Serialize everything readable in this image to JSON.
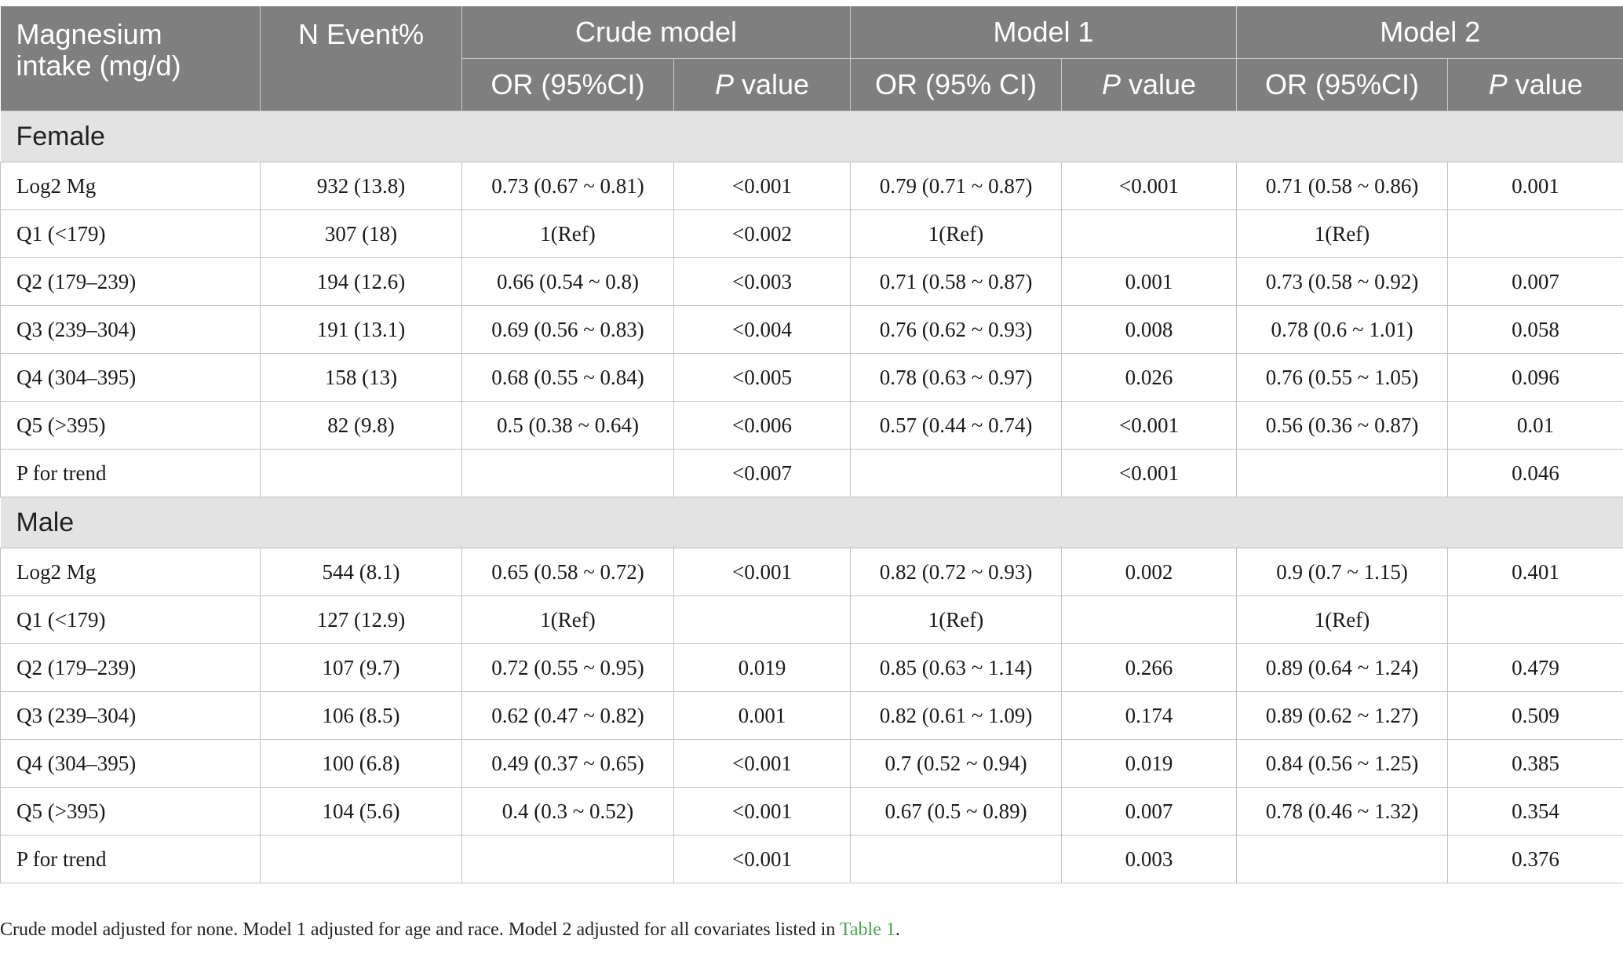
{
  "header": {
    "row_label": "Magnesium intake (mg/d)",
    "n_event": "N Event%",
    "groups": [
      "Crude model",
      "Model 1",
      "Model 2"
    ],
    "or_labels": [
      "OR (95%CI)",
      "OR (95% CI)",
      "OR (95%CI)"
    ],
    "p_label_italic": "P",
    "p_label_rest": " value"
  },
  "sections": [
    {
      "title": "Female",
      "rows": [
        [
          "Log2 Mg",
          "932 (13.8)",
          "0.73 (0.67 ~ 0.81)",
          "<0.001",
          "0.79 (0.71 ~ 0.87)",
          "<0.001",
          "0.71 (0.58 ~ 0.86)",
          "0.001"
        ],
        [
          "Q1 (<179)",
          "307 (18)",
          "1(Ref)",
          "<0.002",
          "1(Ref)",
          "",
          "1(Ref)",
          ""
        ],
        [
          "Q2 (179–239)",
          "194 (12.6)",
          "0.66 (0.54 ~ 0.8)",
          "<0.003",
          "0.71 (0.58 ~ 0.87)",
          "0.001",
          "0.73 (0.58 ~ 0.92)",
          "0.007"
        ],
        [
          "Q3 (239–304)",
          "191 (13.1)",
          "0.69 (0.56 ~ 0.83)",
          "<0.004",
          "0.76 (0.62 ~ 0.93)",
          "0.008",
          "0.78 (0.6 ~ 1.01)",
          "0.058"
        ],
        [
          "Q4 (304–395)",
          "158 (13)",
          "0.68 (0.55 ~ 0.84)",
          "<0.005",
          "0.78 (0.63 ~ 0.97)",
          "0.026",
          "0.76 (0.55 ~ 1.05)",
          "0.096"
        ],
        [
          "Q5 (>395)",
          "82 (9.8)",
          "0.5 (0.38 ~ 0.64)",
          "<0.006",
          "0.57 (0.44 ~ 0.74)",
          "<0.001",
          "0.56 (0.36 ~ 0.87)",
          "0.01"
        ],
        [
          "P for trend",
          "",
          "",
          "<0.007",
          "",
          "<0.001",
          "",
          "0.046"
        ]
      ]
    },
    {
      "title": "Male",
      "rows": [
        [
          "Log2 Mg",
          "544 (8.1)",
          "0.65 (0.58 ~ 0.72)",
          "<0.001",
          "0.82 (0.72 ~ 0.93)",
          "0.002",
          "0.9 (0.7 ~ 1.15)",
          "0.401"
        ],
        [
          "Q1 (<179)",
          "127 (12.9)",
          "1(Ref)",
          "",
          "1(Ref)",
          "",
          "1(Ref)",
          ""
        ],
        [
          "Q2 (179–239)",
          "107 (9.7)",
          "0.72 (0.55 ~ 0.95)",
          "0.019",
          "0.85 (0.63 ~ 1.14)",
          "0.266",
          "0.89 (0.64 ~ 1.24)",
          "0.479"
        ],
        [
          "Q3 (239–304)",
          "106 (8.5)",
          "0.62 (0.47 ~ 0.82)",
          "0.001",
          "0.82 (0.61 ~ 1.09)",
          "0.174",
          "0.89 (0.62 ~ 1.27)",
          "0.509"
        ],
        [
          "Q4 (304–395)",
          "100 (6.8)",
          "0.49 (0.37 ~ 0.65)",
          "<0.001",
          "0.7 (0.52 ~ 0.94)",
          "0.019",
          "0.84 (0.56 ~ 1.25)",
          "0.385"
        ],
        [
          "Q5 (>395)",
          "104 (5.6)",
          "0.4 (0.3 ~ 0.52)",
          "<0.001",
          "0.67 (0.5 ~ 0.89)",
          "0.007",
          "0.78 (0.46 ~ 1.32)",
          "0.354"
        ],
        [
          "P for trend",
          "",
          "",
          "<0.001",
          "",
          "0.003",
          "",
          "0.376"
        ]
      ]
    }
  ],
  "footnote": {
    "text": "Crude model adjusted for none. Model 1 adjusted for age and race. Model 2 adjusted for all covariates listed in ",
    "link": "Table 1",
    "end": "."
  },
  "colors": {
    "header_bg": "#7f7f7f",
    "section_bg": "#e3e3e3",
    "link": "#4aa54e"
  }
}
